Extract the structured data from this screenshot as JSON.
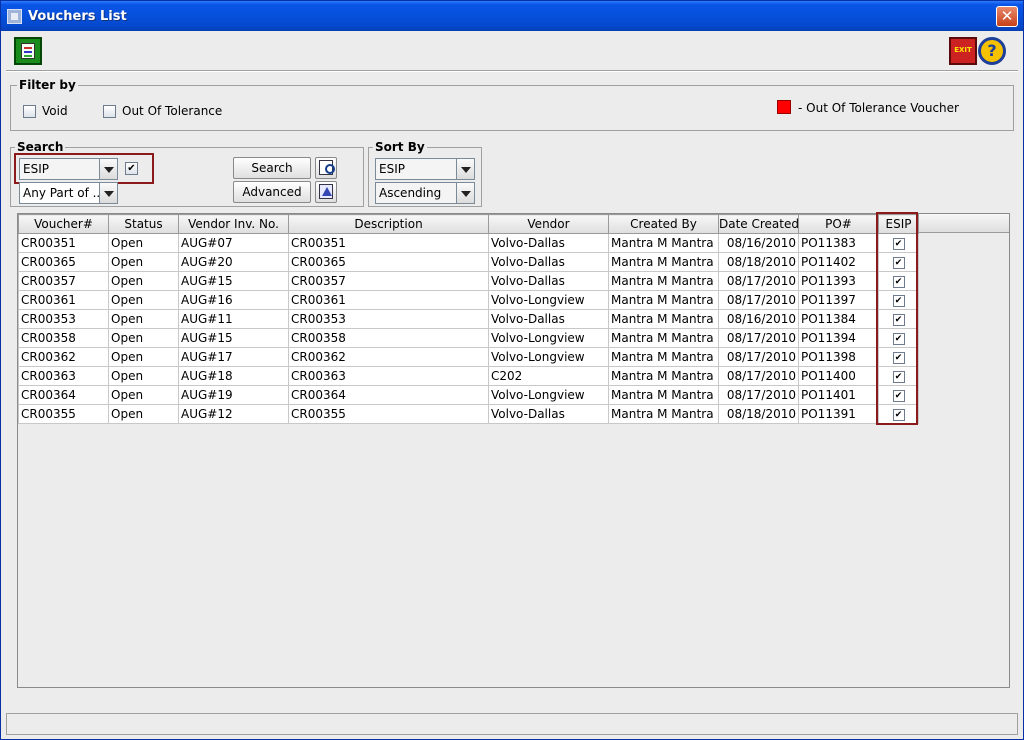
{
  "window": {
    "title": "Vouchers List",
    "close_glyph": "✕"
  },
  "toolbar": {
    "report_icon": "report-icon",
    "exit_label": "EXIT",
    "help_glyph": "?"
  },
  "filter": {
    "legend": "Filter by",
    "void_label": "Void",
    "void_checked": false,
    "oot_label": "Out Of Tolerance",
    "oot_checked": false,
    "legend_swatch_color": "#ff0000",
    "legend_text": "- Out Of Tolerance Voucher"
  },
  "search": {
    "legend": "Search",
    "field_value": "ESIP",
    "field_checkbox": "✔",
    "match_value": "Any Part of ...",
    "search_button": "Search",
    "advanced_button": "Advanced"
  },
  "sort": {
    "legend": "Sort By",
    "field_value": "ESIP",
    "order_value": "Ascending"
  },
  "table": {
    "headers": [
      "Voucher#",
      "Status",
      "Vendor Inv. No.",
      "Description",
      "Vendor",
      "Created By",
      "Date Created",
      "PO#",
      "ESIP"
    ],
    "rows": [
      [
        "CR00351",
        "Open",
        "AUG#07",
        "CR00351",
        "Volvo-Dallas",
        "Mantra M Mantra",
        "08/16/2010",
        "PO11383",
        "✔"
      ],
      [
        "CR00365",
        "Open",
        "AUG#20",
        "CR00365",
        "Volvo-Dallas",
        "Mantra M Mantra",
        "08/18/2010",
        "PO11402",
        "✔"
      ],
      [
        "CR00357",
        "Open",
        "AUG#15",
        "CR00357",
        "Volvo-Dallas",
        "Mantra M Mantra",
        "08/17/2010",
        "PO11393",
        "✔"
      ],
      [
        "CR00361",
        "Open",
        "AUG#16",
        "CR00361",
        "Volvo-Longview",
        "Mantra M Mantra",
        "08/17/2010",
        "PO11397",
        "✔"
      ],
      [
        "CR00353",
        "Open",
        "AUG#11",
        "CR00353",
        "Volvo-Dallas",
        "Mantra M Mantra",
        "08/16/2010",
        "PO11384",
        "✔"
      ],
      [
        "CR00358",
        "Open",
        "AUG#15",
        "CR00358",
        "Volvo-Longview",
        "Mantra M Mantra",
        "08/17/2010",
        "PO11394",
        "✔"
      ],
      [
        "CR00362",
        "Open",
        "AUG#17",
        "CR00362",
        "Volvo-Longview",
        "Mantra M Mantra",
        "08/17/2010",
        "PO11398",
        "✔"
      ],
      [
        "CR00363",
        "Open",
        "AUG#18",
        "CR00363",
        "C202",
        "Mantra M Mantra",
        "08/17/2010",
        "PO11400",
        "✔"
      ],
      [
        "CR00364",
        "Open",
        "AUG#19",
        "CR00364",
        "Volvo-Longview",
        "Mantra M Mantra",
        "08/17/2010",
        "PO11401",
        "✔"
      ],
      [
        "CR00355",
        "Open",
        "AUG#12",
        "CR00355",
        "Volvo-Dallas",
        "Mantra M Mantra",
        "08/18/2010",
        "PO11391",
        "✔"
      ]
    ]
  },
  "statusbar": {
    "text": ""
  }
}
